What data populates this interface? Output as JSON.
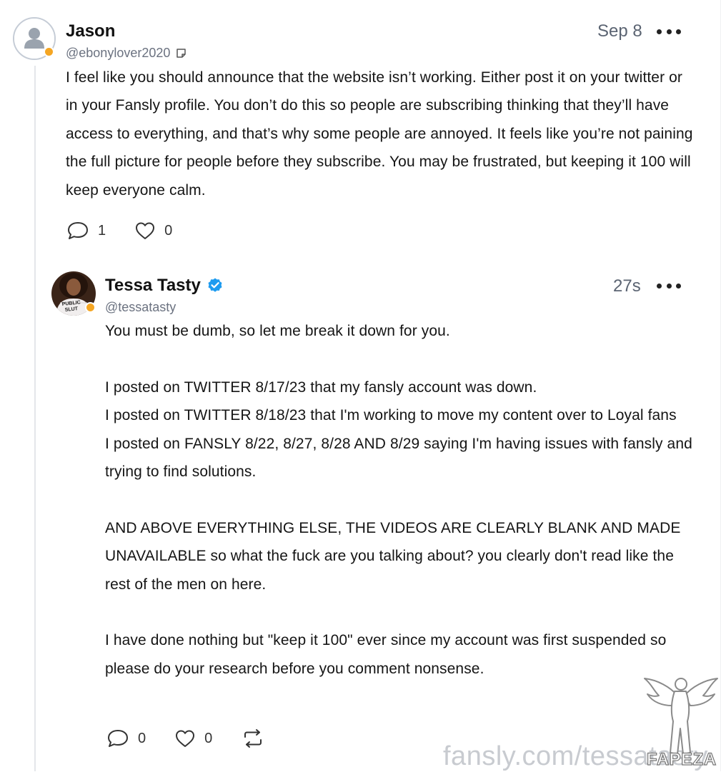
{
  "post": {
    "author": {
      "name": "Jason",
      "handle": "@ebonylover2020",
      "avatar_icon": "default-user-avatar-icon",
      "note_icon": "note-icon"
    },
    "timestamp": "Sep 8",
    "body": "I feel like you should announce that the website isn’t working. Either post it on your twitter or in your Fansly profile. You don’t do this so people are subscribing thinking that they’ll have access to everything, and that’s why some people are annoyed. It feels like you’re not paining the full picture for people before they subscribe. You may be frustrated, but keeping it 100 will keep everyone calm.",
    "reply_count": "1",
    "like_count": "0"
  },
  "reply": {
    "author": {
      "name": "Tessa Tasty",
      "handle": "@tessatasty",
      "verified": true,
      "avatar_text": "PUBLIC SLUT"
    },
    "timestamp": "27s",
    "body": "You must be dumb, so let me break it down for you.\n\nI posted on TWITTER 8/17/23 that my fansly account was down.\nI posted on TWITTER 8/18/23 that I'm working to move my content over to Loyal fans\nI posted on FANSLY 8/22, 8/27, 8/28 AND 8/29 saying I'm having issues with fansly and trying to find solutions.\n\nAND ABOVE EVERYTHING ELSE, THE VIDEOS ARE CLEARLY BLANK AND MADE UNAVAILABLE so what the fuck are you talking about? you clearly don't read like the rest of the men on here.\n\nI have done nothing but \"keep it 100\" ever since my account was first suspended so please do your research before you comment nonsense.",
    "reply_count": "0",
    "like_count": "0"
  },
  "watermark": {
    "url_text": "fansly.com/tessatasty",
    "logo_text": "FAPEZA"
  },
  "colors": {
    "online_dot": "#f5a623",
    "verified_badge": "#1d9bf0",
    "muted_text": "#6b7280",
    "thread_line": "#e4e6ea"
  }
}
